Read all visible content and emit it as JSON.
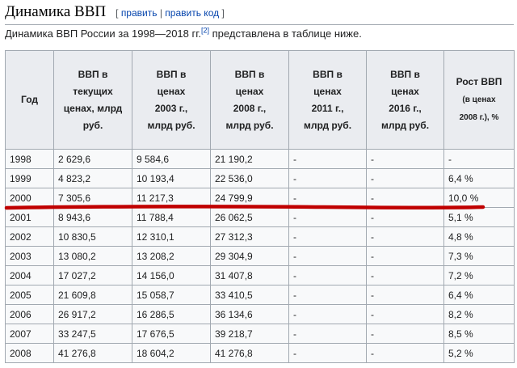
{
  "section": {
    "title": "Динамика ВВП",
    "edit_open": "[",
    "edit_label": "править",
    "edit_sep": "|",
    "edit_code_label": "править код",
    "edit_close": "]"
  },
  "intro": {
    "text": "Динамика ВВП России за 1998—2018 гг.",
    "ref": "[2]",
    "text_after": " представлена в таблице ниже."
  },
  "table": {
    "headers": [
      {
        "lines": [
          "Год"
        ]
      },
      {
        "lines": [
          "ВВП в",
          "текущих",
          "ценах, млрд",
          "руб."
        ]
      },
      {
        "lines": [
          "ВВП в",
          "ценах",
          "2003 г.,",
          "млрд руб."
        ]
      },
      {
        "lines": [
          "ВВП в",
          "ценах",
          "2008 г.,",
          "млрд руб."
        ]
      },
      {
        "lines": [
          "ВВП в",
          "ценах",
          "2011 г.,",
          "млрд руб."
        ]
      },
      {
        "lines": [
          "ВВП в",
          "ценах",
          "2016 г.,",
          "млрд руб."
        ]
      },
      {
        "lines": [
          "Рост ВВП"
        ],
        "small": [
          "(в ценах",
          "2008 г.), %"
        ]
      }
    ],
    "rows": [
      [
        "1998",
        "2 629,6",
        "9 584,6",
        "21 190,2",
        "-",
        "-",
        "-"
      ],
      [
        "1999",
        "4 823,2",
        "10 193,4",
        "22 536,0",
        "-",
        "-",
        "6,4 %"
      ],
      [
        "2000",
        "7 305,6",
        "11 217,3",
        "24 799,9",
        "-",
        "-",
        "10,0 %"
      ],
      [
        "2001",
        "8 943,6",
        "11 788,4",
        "26 062,5",
        "-",
        "-",
        "5,1 %"
      ],
      [
        "2002",
        "10 830,5",
        "12 310,1",
        "27 312,3",
        "-",
        "-",
        "4,8 %"
      ],
      [
        "2003",
        "13 080,2",
        "13 208,2",
        "29 304,9",
        "-",
        "-",
        "7,3 %"
      ],
      [
        "2004",
        "17 027,2",
        "14 156,0",
        "31 407,8",
        "-",
        "-",
        "7,2 %"
      ],
      [
        "2005",
        "21 609,8",
        "15 058,7",
        "33 410,5",
        "-",
        "-",
        "6,4 %"
      ],
      [
        "2006",
        "26 917,2",
        "16 286,5",
        "36 134,6",
        "-",
        "-",
        "8,2 %"
      ],
      [
        "2007",
        "33 247,5",
        "17 676,5",
        "39 218,7",
        "-",
        "-",
        "8,5 %"
      ],
      [
        "2008",
        "41 276,8",
        "18 604,2",
        "41 276,8",
        "-",
        "-",
        "5,2 %"
      ]
    ]
  },
  "annotation": {
    "color": "#c00000",
    "highlight_year": "2000"
  }
}
